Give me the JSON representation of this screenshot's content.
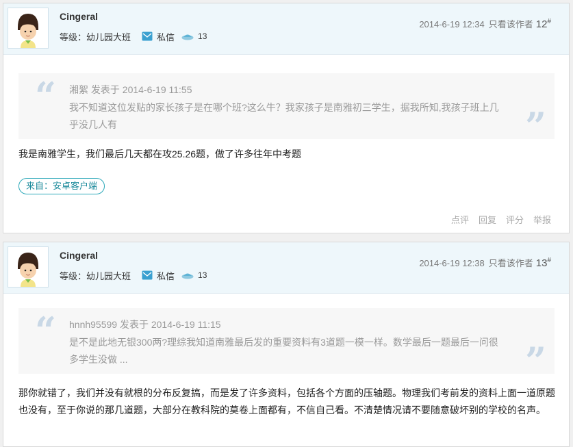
{
  "posts": [
    {
      "username": "Cingeral",
      "level": "等级：幼儿园大班",
      "message_label": "私信",
      "coin_count": "13",
      "timestamp": "2014-6-19 12:34",
      "only_author": "只看该作者",
      "floor_number": "12",
      "floor_mark": "#",
      "quote": {
        "author_line": "湘絮 发表于 2014-6-19 11:55",
        "text": "我不知道这位发贴的家长孩子是在哪个班?这么牛？我家孩子是南雅初三学生，据我所知,我孩子班上几乎没几人有"
      },
      "content": "我是南雅学生，我们最后几天都在攻25.26题，做了许多往年中考题",
      "source_badge": "来自：安卓客户端",
      "actions": [
        "点评",
        "回复",
        "评分",
        "举报"
      ]
    },
    {
      "username": "Cingeral",
      "level": "等级：幼儿园大班",
      "message_label": "私信",
      "coin_count": "13",
      "timestamp": "2014-6-19 12:38",
      "only_author": "只看该作者",
      "floor_number": "13",
      "floor_mark": "#",
      "quote": {
        "author_line": "hnnh95599 发表于 2014-6-19 11:15",
        "text": "是不是此地无银300两?理综我知道南雅最后发的重要资料有3道题一模一样。数学最后一题最后一问很多学生没做 ..."
      },
      "content": "那你就错了，我们并没有就根的分布反复搞，而是发了许多资料，包括各个方面的压轴题。物理我们考前发的资料上面一道原题也没有，至于你说的那几道题，大部分在教科院的莫卷上面都有，不信自己看。不清楚情况请不要随意破坏别的学校的名声。"
    }
  ],
  "colors": {
    "header_bg": "#eef7fb",
    "quote_mark": "#c9d8e6",
    "badge_border": "#2aa7b8",
    "icon_blue": "#3aa0d0"
  },
  "icons": [
    "avatar",
    "mail-icon",
    "coin-icon",
    "open-quote-icon",
    "close-quote-icon"
  ]
}
